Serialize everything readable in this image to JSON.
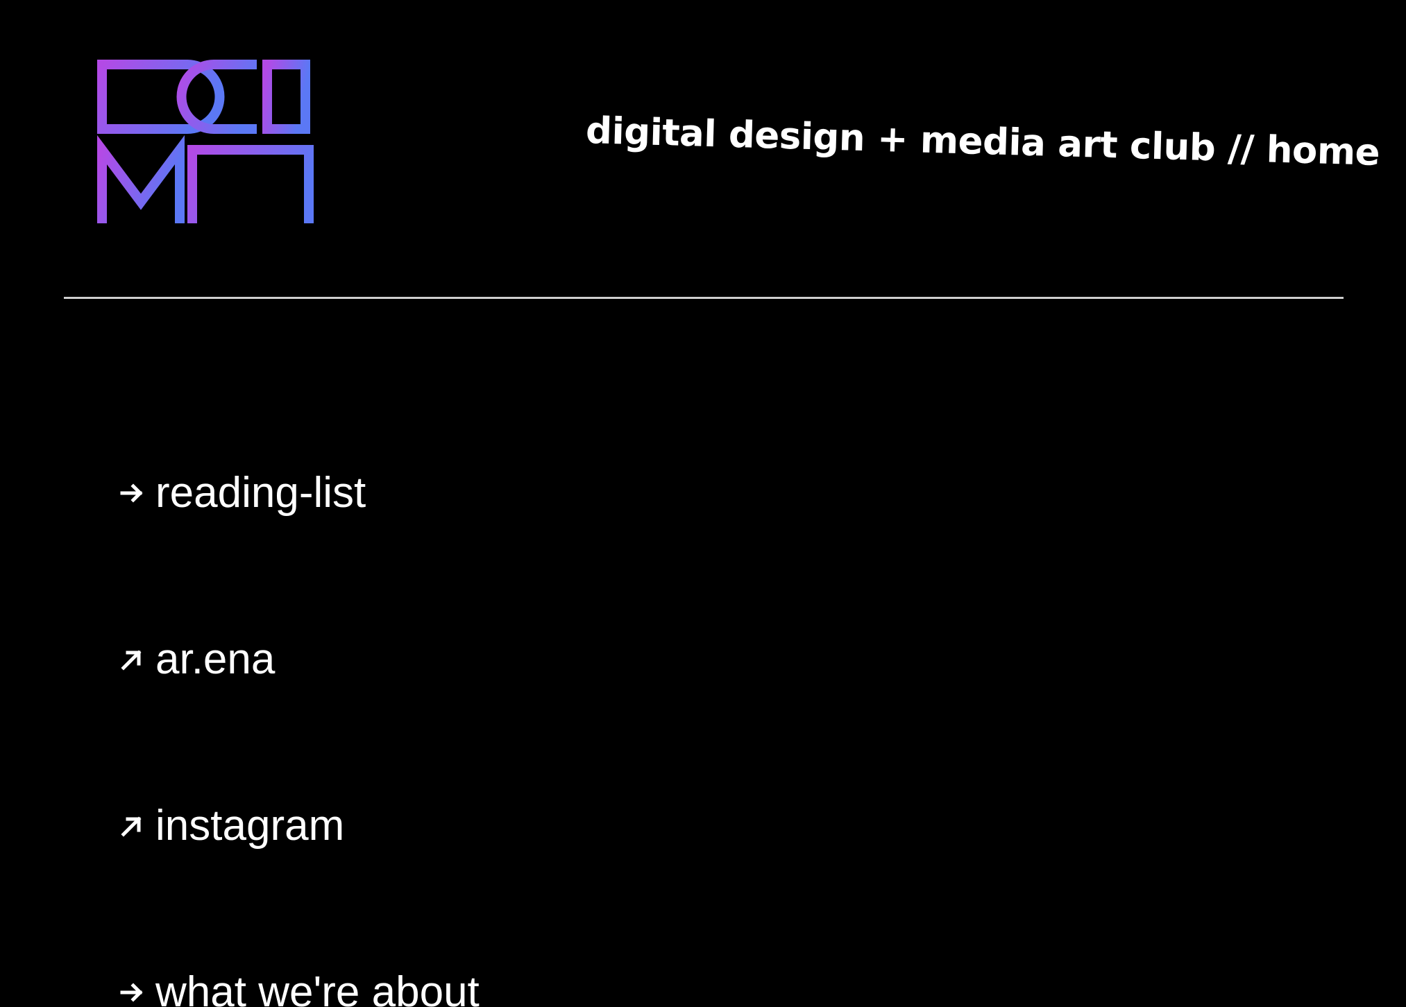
{
  "brand": {
    "logo_text": "DD MA",
    "gradient_start": "#b34ae6",
    "gradient_end": "#5b78f5"
  },
  "header": {
    "tagline": "digital design + media art club // home"
  },
  "nav": {
    "items": [
      {
        "label": "reading-list",
        "icon": "arrow-right-icon"
      },
      {
        "label": "ar.ena",
        "icon": "arrow-up-right-icon"
      },
      {
        "label": "instagram",
        "icon": "arrow-up-right-icon"
      },
      {
        "label": "what we're about",
        "icon": "arrow-right-icon"
      }
    ]
  },
  "colors": {
    "background": "#000000",
    "text": "#ffffff",
    "divider": "#cfcfcf"
  }
}
